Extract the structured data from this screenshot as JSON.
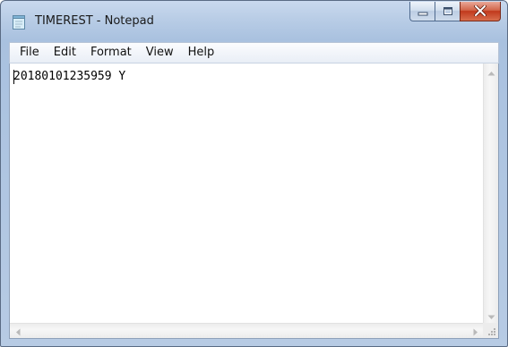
{
  "window": {
    "title": "TIMEREST - Notepad",
    "app_icon": "notepad-icon",
    "controls": {
      "minimize_icon": "minimize-icon",
      "maximize_icon": "maximize-icon",
      "close_icon": "close-icon"
    }
  },
  "menu": {
    "items": [
      {
        "label": "File"
      },
      {
        "label": "Edit"
      },
      {
        "label": "Format"
      },
      {
        "label": "View"
      },
      {
        "label": "Help"
      }
    ]
  },
  "editor": {
    "content": "20180101235959 Y"
  },
  "scrollbars": {
    "up_icon": "scroll-up-arrow-icon",
    "down_icon": "scroll-down-arrow-icon",
    "left_icon": "scroll-left-arrow-icon",
    "right_icon": "scroll-right-arrow-icon",
    "grip_icon": "resize-grip-icon"
  },
  "colors": {
    "frame": "#b9cde6",
    "close_button": "#c1391c",
    "menubar": "#f0f4fa"
  }
}
